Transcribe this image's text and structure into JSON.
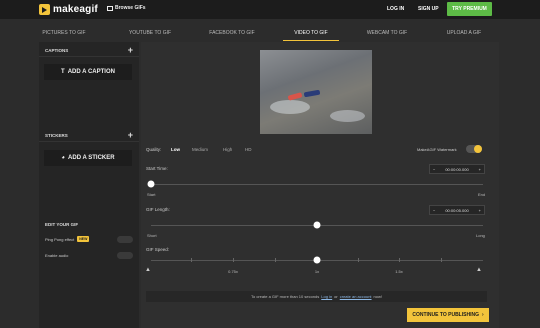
{
  "topbar": {
    "logo_text": "makeagif",
    "browse_label": "Browse GIFs",
    "login": "LOG IN",
    "signup": "SIGN UP",
    "premium": "TRY PREMIUM"
  },
  "tabs": [
    {
      "label": "PICTURES TO GIF"
    },
    {
      "label": "YOUTUBE TO GIF"
    },
    {
      "label": "FACEBOOK TO GIF"
    },
    {
      "label": "VIDEO TO GIF",
      "active": true
    },
    {
      "label": "WEBCAM TO GIF"
    },
    {
      "label": "UPLOAD A GIF"
    }
  ],
  "sidebar": {
    "captions_title": "CAPTIONS",
    "add_caption": "ADD A CAPTION",
    "stickers_title": "STICKERS",
    "add_sticker": "ADD A STICKER",
    "edit_title": "EDIT YOUR GIF",
    "ping_pong": "Ping Pong effect",
    "new_badge": "NEW",
    "enable_audio": "Enable audio"
  },
  "main": {
    "quality_label": "Quality:",
    "quality_options": [
      "Low",
      "Medium",
      "High",
      "HD"
    ],
    "quality_selected": "Low",
    "watermark_label": "MakeAGIF Watermark",
    "watermark_on": true,
    "start_time_label": "Start Time:",
    "start_label": "Start",
    "end_label": "End",
    "start_time_value": "00:00:00.000",
    "start_time_fraction": 0.0,
    "gif_length_label": "GIF Length:",
    "short_label": "Short",
    "long_label": "Long",
    "gif_length_value": "00:00:05.000",
    "gif_length_fraction": 0.5,
    "gif_speed_label": "GIF Speed:",
    "speed_ticks": [
      "0.75x",
      "1x",
      "1.5x"
    ],
    "speed_selected": "1x",
    "note_prefix": "To create a GIF more than 10 seconds",
    "note_login": "Log in",
    "note_or": "or",
    "note_create": "create an account",
    "note_suffix": "now!",
    "continue": "CONTINUE TO PUBLISHING",
    "minus_icon": "−",
    "plus_icon": "+"
  },
  "colors": {
    "accent": "#f3c43b",
    "premium": "#5dbb46"
  }
}
